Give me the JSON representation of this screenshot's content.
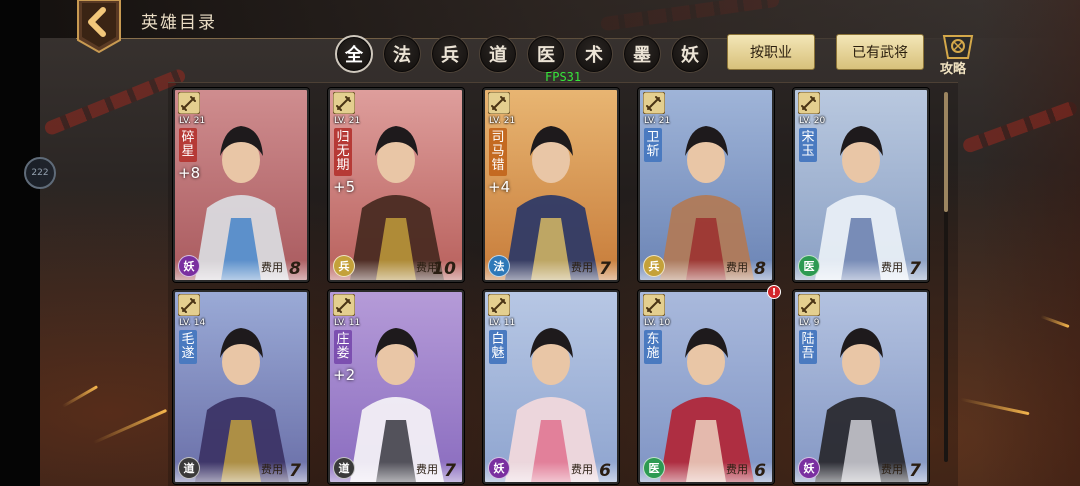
{
  "header": {
    "title": "英雄目录"
  },
  "tabs": [
    {
      "label": "全",
      "active": true
    },
    {
      "label": "法",
      "active": false
    },
    {
      "label": "兵",
      "active": false
    },
    {
      "label": "道",
      "active": false
    },
    {
      "label": "医",
      "active": false
    },
    {
      "label": "术",
      "active": false
    },
    {
      "label": "墨",
      "active": false
    },
    {
      "label": "妖",
      "active": false
    }
  ],
  "sort_buttons": {
    "by_profession": "按职业",
    "owned_generals": "已有武将"
  },
  "strategy": {
    "label": "攻略"
  },
  "fps": "FPS31",
  "side_bubble": "222",
  "cost_label": "费用",
  "heroes": [
    {
      "name": "碎星",
      "level": "LV. 21",
      "bonus": "+8",
      "faction": "妖",
      "cost": "8",
      "name_color": "#b63a36",
      "faction_color": "#7a2fa0",
      "bg": "#cf8d8f",
      "bg2": "#a95a5e",
      "figure": "#d9d9dd",
      "accent": "#3d80c8"
    },
    {
      "name": "归无期",
      "level": "LV. 21",
      "bonus": "+5",
      "faction": "兵",
      "cost": "10",
      "name_color": "#b63a36",
      "faction_color": "#c4a13a",
      "bg": "#de9e9c",
      "bg2": "#b8605c",
      "figure": "#4a2b22",
      "accent": "#c7a23c"
    },
    {
      "name": "司马错",
      "level": "LV. 21",
      "bonus": "+4",
      "faction": "法",
      "cost": "7",
      "name_color": "#c46a21",
      "faction_color": "#2e78b8",
      "bg": "#e8b572",
      "bg2": "#c77c3a",
      "figure": "#2f3a66",
      "accent": "#e0c064"
    },
    {
      "name": "卫斩",
      "level": "LV. 21",
      "bonus": "",
      "faction": "兵",
      "cost": "8",
      "name_color": "#4a7ac0",
      "faction_color": "#c4a13a",
      "bg": "#9fb4d8",
      "bg2": "#6b84b5",
      "figure": "#b07a58",
      "accent": "#9a2a2a"
    },
    {
      "name": "宋玉",
      "level": "LV. 20",
      "bonus": "",
      "faction": "医",
      "cost": "7",
      "name_color": "#4a7ac0",
      "faction_color": "#2d9a52",
      "bg": "#b9c8df",
      "bg2": "#8aa0c4",
      "figure": "#e8eef6",
      "accent": "#5c74a8"
    },
    {
      "name": "毛遂",
      "level": "LV. 14",
      "bonus": "",
      "faction": "道",
      "cost": "7",
      "name_color": "#4a7ac0",
      "faction_color": "#3a3a3a",
      "bg": "#9aaad6",
      "bg2": "#6a6fa8",
      "figure": "#3c3466",
      "accent": "#c9a53c"
    },
    {
      "name": "庄娄",
      "level": "LV. 11",
      "bonus": "+2",
      "faction": "道",
      "cost": "7",
      "name_color": "#7c4fb0",
      "faction_color": "#3a3a3a",
      "bg": "#b59bd8",
      "bg2": "#8a6cbf",
      "figure": "#f2eff5",
      "accent": "#2c2c34"
    },
    {
      "name": "白魅",
      "level": "LV. 11",
      "bonus": "",
      "faction": "妖",
      "cost": "6",
      "name_color": "#4a7ac0",
      "faction_color": "#7a2fa0",
      "bg": "#b7c7e4",
      "bg2": "#8ea4cf",
      "figure": "#f0d8dc",
      "accent": "#e06a8a"
    },
    {
      "name": "东施",
      "level": "LV. 10",
      "bonus": "",
      "faction": "医",
      "cost": "6",
      "name_color": "#4a7ac0",
      "faction_color": "#2d9a52",
      "bg": "#a9b9dc",
      "bg2": "#7f94c4",
      "figure": "#b0283a",
      "accent": "#f1dcc8"
    },
    {
      "name": "陆吾",
      "level": "LV. 9",
      "bonus": "",
      "faction": "妖",
      "cost": "7",
      "name_color": "#4a7ac0",
      "faction_color": "#7a2fa0",
      "bg": "#b3c2e0",
      "bg2": "#8497c4",
      "figure": "#2a2a30",
      "accent": "#d8d8de"
    }
  ]
}
